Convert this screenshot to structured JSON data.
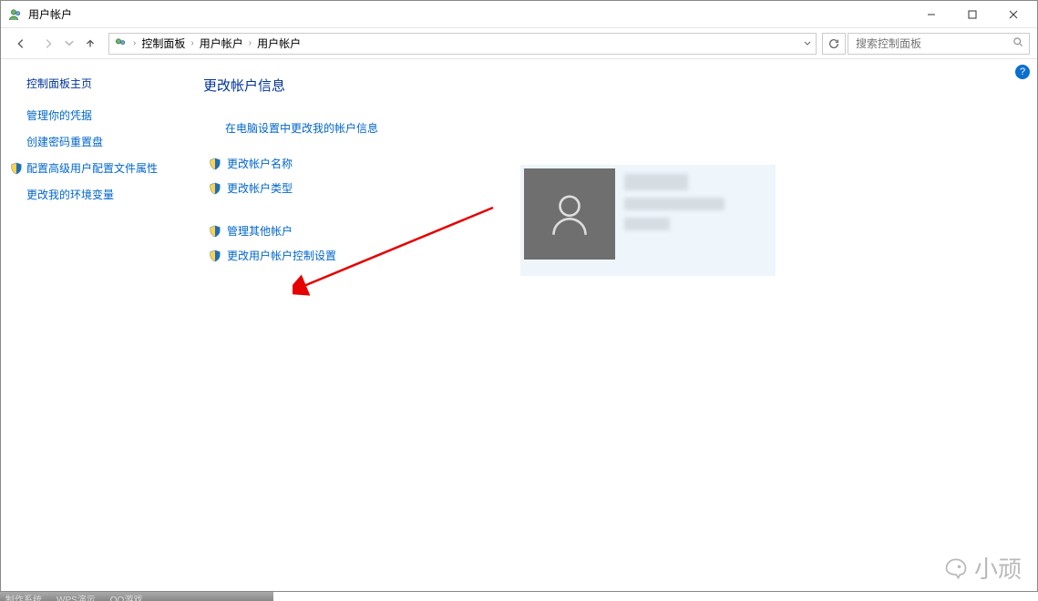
{
  "title": "用户帐户",
  "breadcrumb": {
    "root": "控制面板",
    "mid": "用户帐户",
    "leaf": "用户帐户"
  },
  "search": {
    "placeholder": "搜索控制面板"
  },
  "sidebar": {
    "home": "控制面板主页",
    "links": {
      "credentials": "管理你的凭据",
      "reset_disk": "创建密码重置盘",
      "profile_props": "配置高级用户配置文件属性",
      "env_vars": "更改我的环境变量"
    }
  },
  "main": {
    "heading": "更改帐户信息",
    "pc_settings_link": "在电脑设置中更改我的帐户信息",
    "change_name": "更改帐户名称",
    "change_type": "更改帐户类型",
    "manage_other": "管理其他帐户",
    "change_uac": "更改用户帐户控制设置"
  },
  "watermark": "小顽",
  "desktop_items": [
    "制作系统",
    "WPS演示",
    "QQ游戏"
  ]
}
